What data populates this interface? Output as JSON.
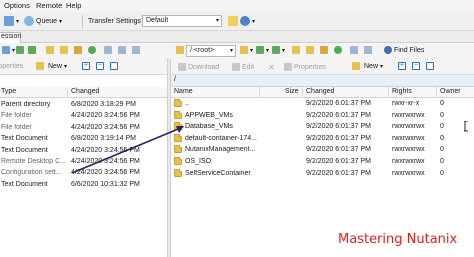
{
  "menu": {
    "options": "Options",
    "remote": "Remote",
    "help": "Help"
  },
  "toolbar": {
    "queue_label": "Queue",
    "transfer_settings_label": "Transfer Settings",
    "transfer_settings_value": "Default"
  },
  "session_tab": "ession",
  "left_panel": {
    "properties_label": "roperties",
    "new_label": "New",
    "columns": {
      "type": "Type",
      "changed": "Changed"
    },
    "rows": [
      {
        "type": "Parent directory",
        "changed": "6/8/2020  3:18:29 PM"
      },
      {
        "type": "File folder",
        "changed": "4/24/2020  3:24:56 PM"
      },
      {
        "type": "File folder",
        "changed": "4/24/2020  3:24:56 PM"
      },
      {
        "type": "Text Document",
        "changed": "6/8/2020  3:19:14 PM"
      },
      {
        "type": "Text Document",
        "changed": "4/24/2020  3:24:56 PM"
      },
      {
        "type": "Remote Desktop C...",
        "changed": "4/24/2020  3:24:56 PM"
      },
      {
        "type": "Configuration sett...",
        "changed": "4/24/2020  3:24:56 PM"
      },
      {
        "type": "Text Document",
        "changed": "6/6/2020  10:31:32 PM"
      }
    ]
  },
  "right_panel": {
    "path_combo": "/ <root>",
    "find_files_label": "Find Files",
    "download_label": "Download",
    "edit_label": "Edit",
    "properties_label": "Properties",
    "new_label": "New",
    "path": "/",
    "columns": {
      "name": "Name",
      "size": "Size",
      "changed": "Changed",
      "rights": "Rights",
      "owner": "Owner"
    },
    "rows": [
      {
        "name": "..",
        "changed": "9/2/2020  6:01:37 PM",
        "rights": "rwxr-xr-x",
        "owner": "0"
      },
      {
        "name": "APPWEB_VMs",
        "changed": "9/2/2020  6:01:37 PM",
        "rights": "rwxrwxrwx",
        "owner": "0"
      },
      {
        "name": "Database_VMs",
        "changed": "9/2/2020  6:01:37 PM",
        "rights": "rwxrwxrwx",
        "owner": "0"
      },
      {
        "name": "default-container-174...",
        "changed": "9/2/2020  6:01:37 PM",
        "rights": "rwxrwxrwx",
        "owner": "0"
      },
      {
        "name": "NutanixManagement...",
        "changed": "9/2/2020  6:01:37 PM",
        "rights": "rwxrwxrwx",
        "owner": "0"
      },
      {
        "name": "OS_ISO",
        "changed": "9/2/2020  6:01:37 PM",
        "rights": "rwxrwxrwx",
        "owner": "0"
      },
      {
        "name": "SelfServiceContainer",
        "changed": "9/2/2020  6:01:37 PM",
        "rights": "rwxrwxrwx",
        "owner": "0"
      }
    ]
  },
  "watermark": "Mastering Nutanix",
  "colors": {
    "folder": "#e8c04a",
    "path_bar": "#e6eef8",
    "watermark": "#e02020",
    "arrow": "#3a1f5e"
  }
}
